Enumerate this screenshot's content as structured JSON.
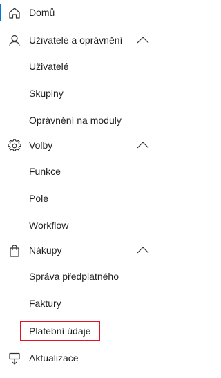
{
  "nav": {
    "home": {
      "label": "Domů",
      "icon": "home-icon",
      "active": true
    },
    "users_group": {
      "label": "Uživatelé a oprávnění",
      "icon": "person-icon",
      "expanded": true,
      "items": [
        "Uživatelé",
        "Skupiny",
        "Oprávnění na moduly"
      ]
    },
    "settings_group": {
      "label": "Volby",
      "icon": "gear-icon",
      "expanded": true,
      "items": [
        "Funkce",
        "Pole",
        "Workflow"
      ]
    },
    "purchases_group": {
      "label": "Nákupy",
      "icon": "shopping-bag-icon",
      "expanded": true,
      "items": [
        "Správa předplatného",
        "Faktury",
        "Platební údaje"
      ]
    },
    "updates": {
      "label": "Aktualizace",
      "icon": "update-icon"
    }
  },
  "colors": {
    "accent": "#0078d4",
    "highlight": "#e81123",
    "text": "#201f1e"
  }
}
